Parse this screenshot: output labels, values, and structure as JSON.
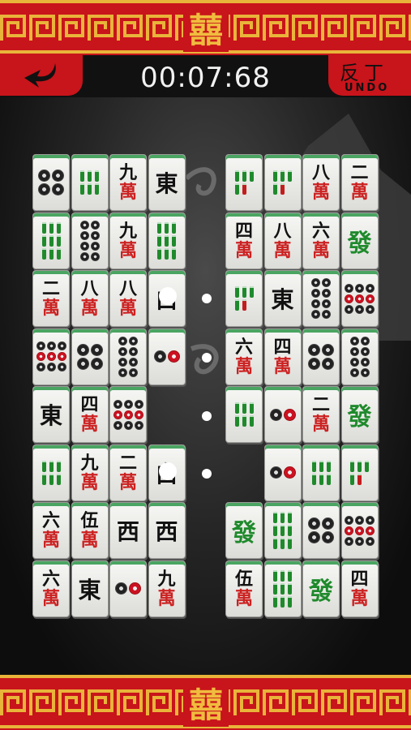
{
  "header": {
    "emblem": "囍",
    "timer": "00:07:68",
    "undo_glyph": "反丁",
    "undo_label": "UNDO"
  },
  "colors": {
    "banner_red": "#c8141b",
    "banner_gold": "#e9b43a",
    "tile_face": "#f2f2ef",
    "tile_edge": "#4aa562",
    "character_red": "#cc2222",
    "bamboo_green": "#1f8a2c"
  },
  "board": {
    "left_block": [
      [
        {
          "kind": "dots",
          "n": 4
        },
        {
          "kind": "bamboo",
          "n": 6
        },
        {
          "kind": "char",
          "num": "九"
        },
        {
          "kind": "wind",
          "glyph": "東"
        }
      ],
      [
        {
          "kind": "bamboo",
          "n": 9
        },
        {
          "kind": "dots",
          "n": 8
        },
        {
          "kind": "char",
          "num": "九"
        },
        {
          "kind": "bamboo",
          "n": 9
        }
      ],
      [
        {
          "kind": "char",
          "num": "二"
        },
        {
          "kind": "char",
          "num": "八"
        },
        {
          "kind": "char",
          "num": "八"
        },
        {
          "kind": "wind",
          "glyph": "白"
        }
      ],
      [
        {
          "kind": "dots",
          "n": 9
        },
        {
          "kind": "dots",
          "n": 4
        },
        {
          "kind": "dots",
          "n": 8
        },
        {
          "kind": "dots",
          "n": 2
        }
      ],
      [
        {
          "kind": "wind",
          "glyph": "東"
        },
        {
          "kind": "char",
          "num": "四"
        },
        {
          "kind": "dots",
          "n": 9
        }
      ],
      [
        {
          "kind": "bamboo",
          "n": 6
        },
        {
          "kind": "char",
          "num": "九"
        },
        {
          "kind": "char",
          "num": "二"
        },
        {
          "kind": "wind",
          "glyph": "白"
        }
      ],
      [
        {
          "kind": "char",
          "num": "六"
        },
        {
          "kind": "char",
          "num": "伍"
        },
        {
          "kind": "wind",
          "glyph": "西"
        },
        {
          "kind": "wind",
          "glyph": "西"
        }
      ],
      [
        {
          "kind": "char",
          "num": "六"
        },
        {
          "kind": "wind",
          "glyph": "東"
        },
        {
          "kind": "dots",
          "n": 2
        },
        {
          "kind": "char",
          "num": "九"
        }
      ]
    ],
    "right_block": [
      [
        {
          "kind": "bamboo",
          "n": 5
        },
        {
          "kind": "bamboo",
          "n": 5
        },
        {
          "kind": "char",
          "num": "八"
        },
        {
          "kind": "char",
          "num": "二"
        }
      ],
      [
        {
          "kind": "char",
          "num": "四"
        },
        {
          "kind": "char",
          "num": "八"
        },
        {
          "kind": "char",
          "num": "六"
        },
        {
          "kind": "green",
          "glyph": "發"
        }
      ],
      [
        {
          "kind": "bamboo",
          "n": 5
        },
        {
          "kind": "wind",
          "glyph": "東"
        },
        {
          "kind": "dots",
          "n": 8
        },
        {
          "kind": "dots",
          "n": 9
        }
      ],
      [
        {
          "kind": "char",
          "num": "六"
        },
        {
          "kind": "char",
          "num": "四"
        },
        {
          "kind": "dots",
          "n": 4
        },
        {
          "kind": "dots",
          "n": 8
        }
      ],
      [
        {
          "kind": "bamboo",
          "n": 6
        },
        {
          "kind": "dots",
          "n": 2
        },
        {
          "kind": "char",
          "num": "二"
        },
        {
          "kind": "green",
          "glyph": "發"
        }
      ],
      [
        null,
        {
          "kind": "dots",
          "n": 2
        },
        {
          "kind": "bamboo",
          "n": 6
        },
        {
          "kind": "bamboo",
          "n": 5
        }
      ],
      [
        {
          "kind": "green",
          "glyph": "發"
        },
        {
          "kind": "bamboo",
          "n": 9
        },
        {
          "kind": "dots",
          "n": 4
        },
        {
          "kind": "dots",
          "n": 9
        }
      ],
      [
        {
          "kind": "char",
          "num": "伍"
        },
        {
          "kind": "bamboo",
          "n": 9
        },
        {
          "kind": "green",
          "glyph": "發"
        },
        {
          "kind": "char",
          "num": "四"
        }
      ]
    ],
    "wan_glyph": "萬"
  }
}
